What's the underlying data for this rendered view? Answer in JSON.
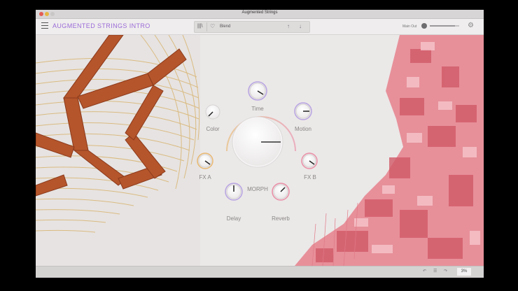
{
  "window": {
    "title": "Augmented Strings"
  },
  "toolbar": {
    "plugin_name": "AUGMENTED STRINGS INTRO",
    "preset_name": "Blend",
    "main_out_label": "Main Out",
    "main_out_level": 0.85,
    "menu_icon": "hamburger-icon",
    "browser_icon": "library-icon",
    "favorite_icon": "heart-icon",
    "settings_icon": "gear-icon"
  },
  "knobs": {
    "time": "Time",
    "color": "Color",
    "motion": "Motion",
    "fx_a": "FX A",
    "fx_b": "FX B",
    "morph": "MORPH",
    "delay": "Delay",
    "reverb": "Reverb"
  },
  "status": {
    "undo_icon": "undo-icon",
    "redo_icon": "redo-icon",
    "history_icon": "history-icon",
    "zoom": "3%"
  },
  "colors": {
    "accent_purple": "#9a6ad8",
    "ring_orange": "#e7b26b",
    "ring_pink": "#e98aa3"
  }
}
